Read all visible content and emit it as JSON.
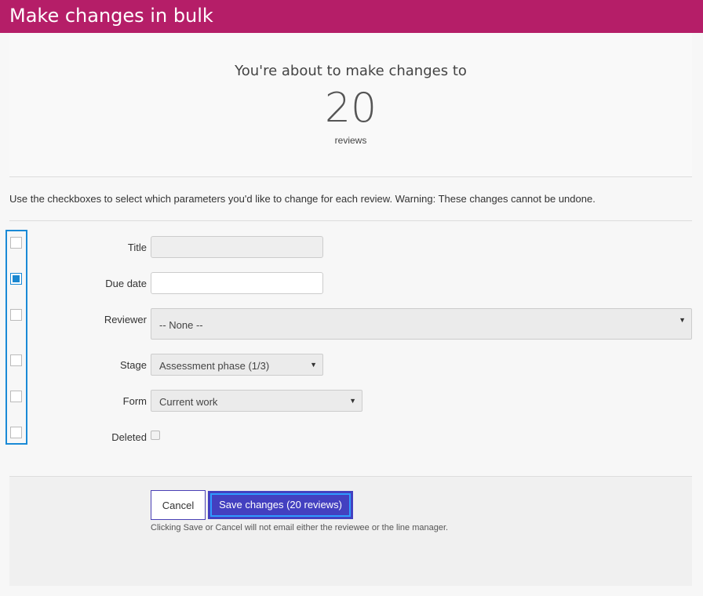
{
  "header": {
    "title": "Make changes in bulk"
  },
  "summary": {
    "lead": "You're about to make changes to",
    "count": "20",
    "unit": "reviews"
  },
  "instructions": "Use the checkboxes to select which parameters you'd like to change for each review. Warning: These changes cannot be undone.",
  "fields": {
    "title": {
      "label": "Title",
      "value": "",
      "enabled": false
    },
    "due_date": {
      "label": "Due date",
      "value": "",
      "enabled": true
    },
    "reviewer": {
      "label": "Reviewer",
      "selected": "-- None --",
      "enabled": false
    },
    "stage": {
      "label": "Stage",
      "selected": "Assessment phase (1/3)",
      "enabled": false
    },
    "form": {
      "label": "Form",
      "selected": "Current work",
      "enabled": false
    },
    "deleted": {
      "label": "Deleted",
      "checked": false,
      "enabled": false
    }
  },
  "actions": {
    "cancel_label": "Cancel",
    "save_label": "Save changes (20 reviews)",
    "note": "Clicking Save or Cancel will not email either the reviewee or the line manager."
  },
  "colors": {
    "header": "#b51e68",
    "primary_button": "#4340c0",
    "focus_ring": "#1a8ad6"
  }
}
